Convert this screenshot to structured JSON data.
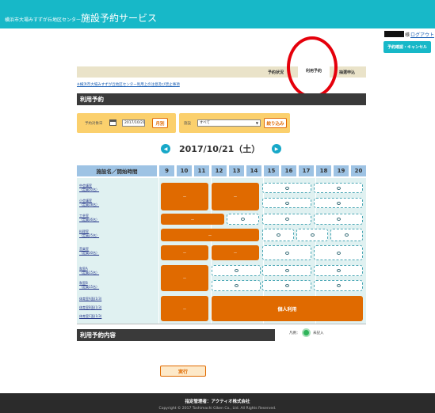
{
  "header": {
    "title_prefix": "横浜市大場みすずが丘地区センター",
    "title_main": "施設予約サービス"
  },
  "user": {
    "name_suffix": "様",
    "logout_label": "ログアウト",
    "confirm_button": "予約確認・キャンセル"
  },
  "nav": {
    "tabs": [
      {
        "label": "予約状況"
      },
      {
        "label": "利用予約"
      },
      {
        "label": "抽選申込"
      }
    ]
  },
  "notice_link": "※横浜市大場みすずが丘地区センター利用上の注意及び禁止事項",
  "section_title": "利用予約",
  "filters": {
    "date_label": "予約対象日",
    "date_value": "2017/10/21",
    "month_button": "月別",
    "facility_label": "施設",
    "facility_value": "すべて",
    "narrow_button": "絞り込み",
    "calendar_icon": "calendar-icon"
  },
  "date_nav": {
    "current": "2017/10/21（土）",
    "prev_symbol": "◀",
    "next_symbol": "▶"
  },
  "grid": {
    "facility_header": "施設名／開始時間",
    "hours": [
      "9",
      "10",
      "11",
      "12",
      "13",
      "14",
      "15",
      "16",
      "17",
      "18",
      "19",
      "20"
    ],
    "rows": [
      {
        "name": "中会議室",
        "capacity": "（定員50名）"
      },
      {
        "name": "小会議室",
        "capacity": "（定員18名）"
      },
      {
        "name": "工芸室",
        "capacity": "（定員36名）"
      },
      {
        "name": "料理室",
        "capacity": "（定員25名）"
      },
      {
        "name": "音楽室",
        "capacity": "（定員30名）"
      },
      {
        "name": "和室A",
        "capacity": "（定員15名）"
      },
      {
        "name": "和室B",
        "capacity": "（定員15名）"
      },
      {
        "name": "体育室A面(1/3)",
        "capacity": ""
      },
      {
        "name": "体育室B面(1/3)",
        "capacity": ""
      },
      {
        "name": "体育室C面(1/3)",
        "capacity": ""
      }
    ],
    "booked_mark": "－",
    "personal_use_label": "個人利用"
  },
  "section2_title": "利用予約内容",
  "legend": {
    "label": "凡例：",
    "text": "未記入"
  },
  "submit_label": "実行",
  "footer": {
    "manager": "指定管理者：アクティオ株式会社",
    "copyright": "Copyright © 2017 Toshimachi Giken Co., Ltd. All Rights Reserved."
  },
  "colors": {
    "header": "#17b8c8",
    "booked": "#e06a00",
    "free_border": "#4aa7b5",
    "grid_bg": "#e0f1f1",
    "grid_header": "#9ec3e4",
    "filter_panel": "#fbd06d",
    "annotation_circle": "#e5000b"
  }
}
